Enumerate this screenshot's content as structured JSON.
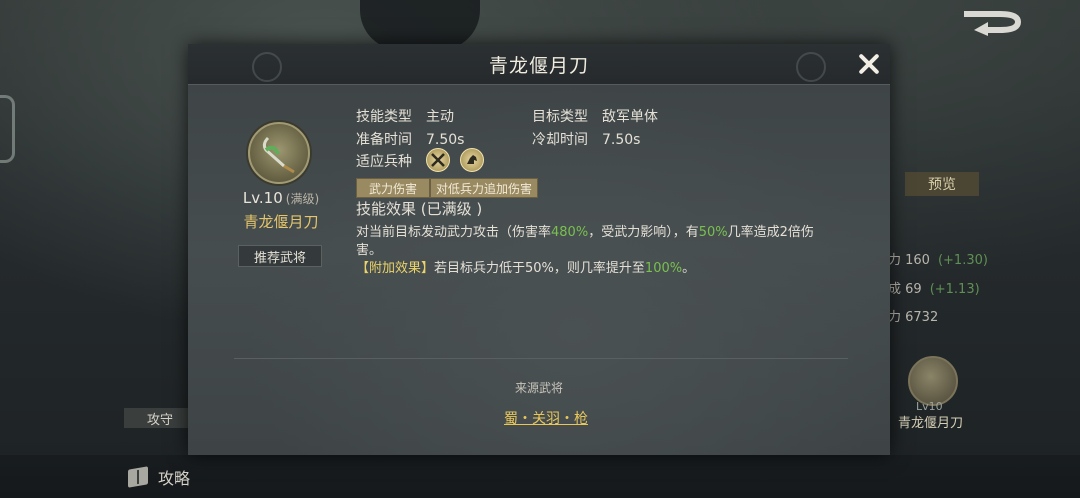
{
  "background": {
    "preview_label": "预览",
    "stats": [
      {
        "label": "力 160",
        "plus": "(+1.30)"
      },
      {
        "label": "成 69",
        "plus": "(+1.13)"
      },
      {
        "label": "力 6732",
        "plus": ""
      }
    ],
    "side_skill": {
      "level": "Lv10",
      "name": "青龙偃月刀"
    },
    "gongshou_label": "攻守",
    "gonglue_label": "攻略"
  },
  "modal": {
    "title": "青龙偃月刀",
    "level": "Lv.10",
    "level_suffix": "(满级)",
    "skill_name": "青龙偃月刀",
    "recommend_button": "推荐武将",
    "skill_type_label": "技能类型",
    "skill_type_value": "主动",
    "target_type_label": "目标类型",
    "target_type_value": "敌军单体",
    "prep_time_label": "准备时间",
    "prep_time_value": "7.50s",
    "cooldown_label": "冷却时间",
    "cooldown_value": "7.50s",
    "adapt_label": "适应兵种",
    "adapt_icons": [
      "crossed-weapons-icon",
      "cavalry-horse-icon"
    ],
    "tags": [
      "武力伤害",
      "对低兵力追加伤害"
    ],
    "effect_title": "技能效果 (已满级 )",
    "desc_line1_a": "对当前目标发动武力攻击（伤害率",
    "desc_rate": "480%",
    "desc_line1_b": "，受武力影响），有",
    "desc_chance": "50%",
    "desc_line1_c": "几率造成2倍伤害。",
    "extra_label": "【附加效果】",
    "extra_text_a": "若目标兵力低于50%，则几率提升至",
    "extra_value": "100%",
    "extra_text_b": "。",
    "source_label": "来源武将",
    "source_link": "蜀・关羽・枪"
  }
}
